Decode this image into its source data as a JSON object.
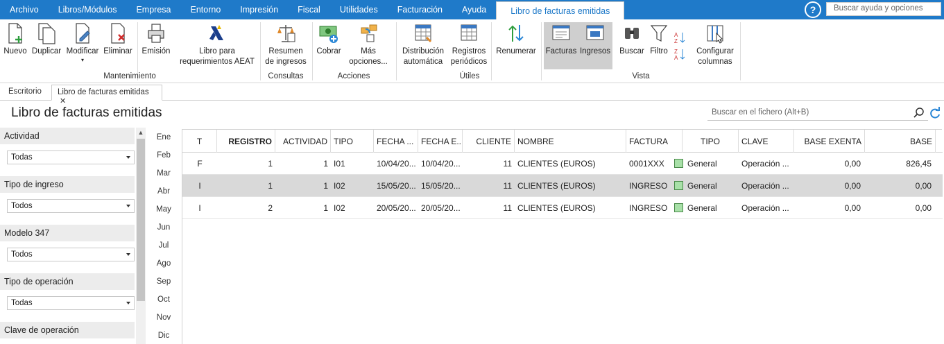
{
  "menu": {
    "items": [
      "Archivo",
      "Libros/Módulos",
      "Empresa",
      "Entorno",
      "Impresión",
      "Fiscal",
      "Utilidades",
      "Facturación",
      "Ayuda"
    ],
    "active_tab": "Libro de facturas emitidas",
    "help_search_placeholder": "Buscar ayuda y opciones"
  },
  "ribbon": {
    "buttons": {
      "nuevo": "Nuevo",
      "duplicar": "Duplicar",
      "modificar": "Modificar",
      "eliminar": "Eliminar",
      "emision": "Emisión",
      "libro_aeat_1": "Libro para",
      "libro_aeat_2": "requerimientos AEAT",
      "resumen_1": "Resumen",
      "resumen_2": "de ingresos",
      "cobrar": "Cobrar",
      "mas_1": "Más",
      "mas_2": "opciones...",
      "distrib_1": "Distribución",
      "distrib_2": "automática",
      "registros_1": "Registros",
      "registros_2": "periódicos",
      "renumerar": "Renumerar",
      "facturas": "Facturas",
      "ingresos": "Ingresos",
      "buscar": "Buscar",
      "filtro": "Filtro",
      "configurar_1": "Configurar",
      "configurar_2": "columnas"
    },
    "groups": {
      "mantenimiento": "Mantenimiento",
      "consultas": "Consultas",
      "acciones": "Acciones",
      "utiles": "Útiles",
      "vista": "Vista"
    }
  },
  "doc_tabs": {
    "escritorio": "Escritorio",
    "libro": "Libro de facturas emitidas",
    "close": "✕"
  },
  "page": {
    "title": "Libro de facturas emitidas",
    "search_placeholder": "Buscar en el fichero (Alt+B)"
  },
  "filters": [
    {
      "label": "Actividad",
      "value": "Todas"
    },
    {
      "label": "Tipo de ingreso",
      "value": "Todos"
    },
    {
      "label": "Modelo 347",
      "value": "Todos"
    },
    {
      "label": "Tipo de operación",
      "value": "Todas"
    },
    {
      "label": "Clave de operación",
      "value": ""
    }
  ],
  "months": [
    "Ene",
    "Feb",
    "Mar",
    "Abr",
    "May",
    "Jun",
    "Jul",
    "Ago",
    "Sep",
    "Oct",
    "Nov",
    "Dic"
  ],
  "grid": {
    "columns": [
      "T",
      "REGISTRO",
      "ACTIVIDAD",
      "TIPO",
      "FECHA ...",
      "FECHA E...",
      "CLIENTE",
      "NOMBRE",
      "FACTURA",
      "TIPO",
      "CLAVE",
      "BASE EXENTA",
      "BASE"
    ],
    "rows": [
      {
        "t": "F",
        "registro": "1",
        "actividad": "1",
        "tipo": "I01",
        "fecha": "10/04/20...",
        "fecha_e": "10/04/20...",
        "cliente": "11",
        "nombre": "CLIENTES (EUROS)",
        "factura": "0001XXX",
        "tipo2": "General",
        "clave": "Operación ...",
        "base_exenta": "0,00",
        "base": "826,45"
      },
      {
        "t": "I",
        "registro": "1",
        "actividad": "1",
        "tipo": "I02",
        "fecha": "15/05/20...",
        "fecha_e": "15/05/20...",
        "cliente": "11",
        "nombre": "CLIENTES (EUROS)",
        "factura": "INGRESO",
        "tipo2": "General",
        "clave": "Operación ...",
        "base_exenta": "0,00",
        "base": "0,00"
      },
      {
        "t": "I",
        "registro": "2",
        "actividad": "1",
        "tipo": "I02",
        "fecha": "20/05/20...",
        "fecha_e": "20/05/20...",
        "cliente": "11",
        "nombre": "CLIENTES (EUROS)",
        "factura": "INGRESO",
        "tipo2": "General",
        "clave": "Operación ...",
        "base_exenta": "0,00",
        "base": "0,00"
      }
    ],
    "selected_row": 1
  },
  "colors": {
    "accent": "#1f7ac9",
    "swatch": "#a8e0a8",
    "selected_row": "#d9d9d9"
  }
}
